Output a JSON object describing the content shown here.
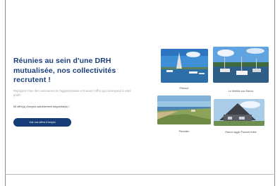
{
  "hero": {
    "title": "Réunies au sein d'une DRH mutualisée, nos collectivités recrutent !",
    "intro": "Rejoignez l'une des communes de l'agglomération et trouvez l'offre qui correspond à votre profil !",
    "offers_line": "65 offre(s) d'emploi actuellement disponible(s) !",
    "cta_label": "Voir nos offres d'emploi"
  },
  "cards": [
    {
      "name": "Pléneuf",
      "icon": "harbor-photo"
    },
    {
      "name": "Le Minihic-sur-Rance",
      "icon": "boats-photo"
    },
    {
      "name": "Pénéstin",
      "icon": "coast-photo"
    },
    {
      "name": "Rance agglo Faoulet flotte",
      "icon": "building-photo"
    }
  ],
  "colors": {
    "brand": "#1a3e7c",
    "button": "#163d78",
    "muted_text": "#9ea4ab"
  }
}
